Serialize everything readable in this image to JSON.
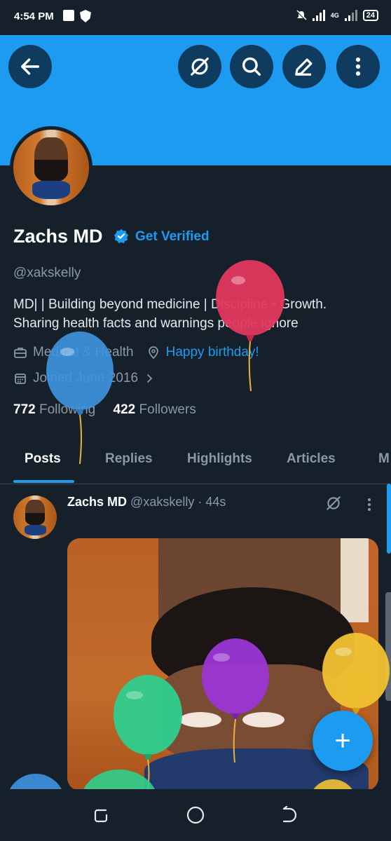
{
  "status_bar": {
    "time": "4:54 PM",
    "network": "4G",
    "battery": "24"
  },
  "profile": {
    "name": "Zachs MD",
    "get_verified": "Get Verified",
    "handle": "@xakskelly",
    "bio_line1": "MD|   | Building beyond medicine |  Discipline • Growth.",
    "bio_line2": "Sharing health facts and warnings people ignore",
    "category": "Medical & Health",
    "location": "Happy birthday!",
    "joined": "Joined June 2016",
    "following_count": "772",
    "following_label": "Following",
    "followers_count": "422",
    "followers_label": "Followers"
  },
  "tabs": [
    "Posts",
    "Replies",
    "Highlights",
    "Articles",
    "M"
  ],
  "active_tab": "Posts",
  "post": {
    "author": "Zachs MD",
    "handle": "@xakskelly",
    "time": "44s"
  },
  "fab_label": "+",
  "colors": {
    "accent": "#1d9bf0",
    "background": "#15202b",
    "banner": "#1d9bf0"
  },
  "icons": {
    "back": "arrow-left-icon",
    "grok": "grok-icon",
    "search": "search-icon",
    "edit": "edit-icon",
    "more": "more-vertical-icon",
    "verified": "verified-badge-icon"
  }
}
